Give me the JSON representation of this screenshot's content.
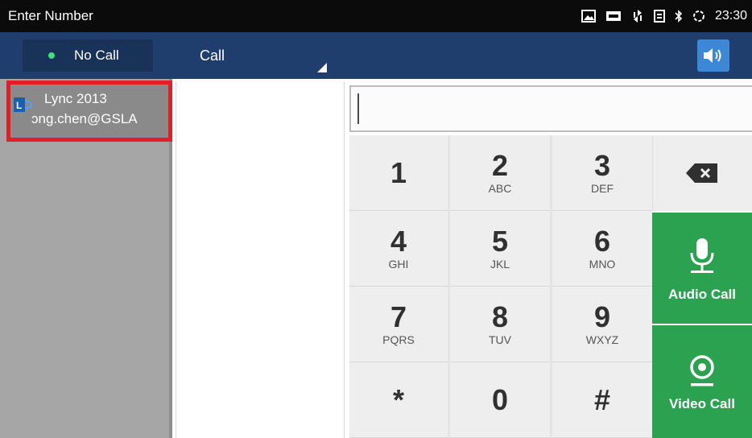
{
  "statusbar": {
    "title": "Enter Number",
    "icons": [
      "image-icon",
      "ftp-icon",
      "sync-icon",
      "sim-icon",
      "bluetooth-icon",
      "loading-icon"
    ],
    "time": "23:30"
  },
  "actionbar": {
    "status_label": "No Call",
    "status_color": "#3ee07a",
    "call_mode_label": "Call",
    "volume_icon": "speaker-icon"
  },
  "account": {
    "name": "Lync 2013",
    "address": "ɔng.chen@GSLA",
    "logo_letter": "L",
    "highlight_color": "#e21f26"
  },
  "input": {
    "value": ""
  },
  "keypad": {
    "keys": [
      {
        "digit": "1",
        "letters": ""
      },
      {
        "digit": "2",
        "letters": "ABC"
      },
      {
        "digit": "3",
        "letters": "DEF"
      },
      {
        "digit": "4",
        "letters": "GHI"
      },
      {
        "digit": "5",
        "letters": "JKL"
      },
      {
        "digit": "6",
        "letters": "MNO"
      },
      {
        "digit": "7",
        "letters": "PQRS"
      },
      {
        "digit": "8",
        "letters": "TUV"
      },
      {
        "digit": "9",
        "letters": "WXYZ"
      },
      {
        "digit": "*",
        "letters": ""
      },
      {
        "digit": "0",
        "letters": ""
      },
      {
        "digit": "#",
        "letters": ""
      }
    ]
  },
  "actions": {
    "audio_label": "Audio Call",
    "video_label": "Video Call",
    "accent_color": "#2aa24f"
  },
  "colors": {
    "actionbar": "#1f3e6e",
    "statusbar": "#0b0b0b"
  }
}
